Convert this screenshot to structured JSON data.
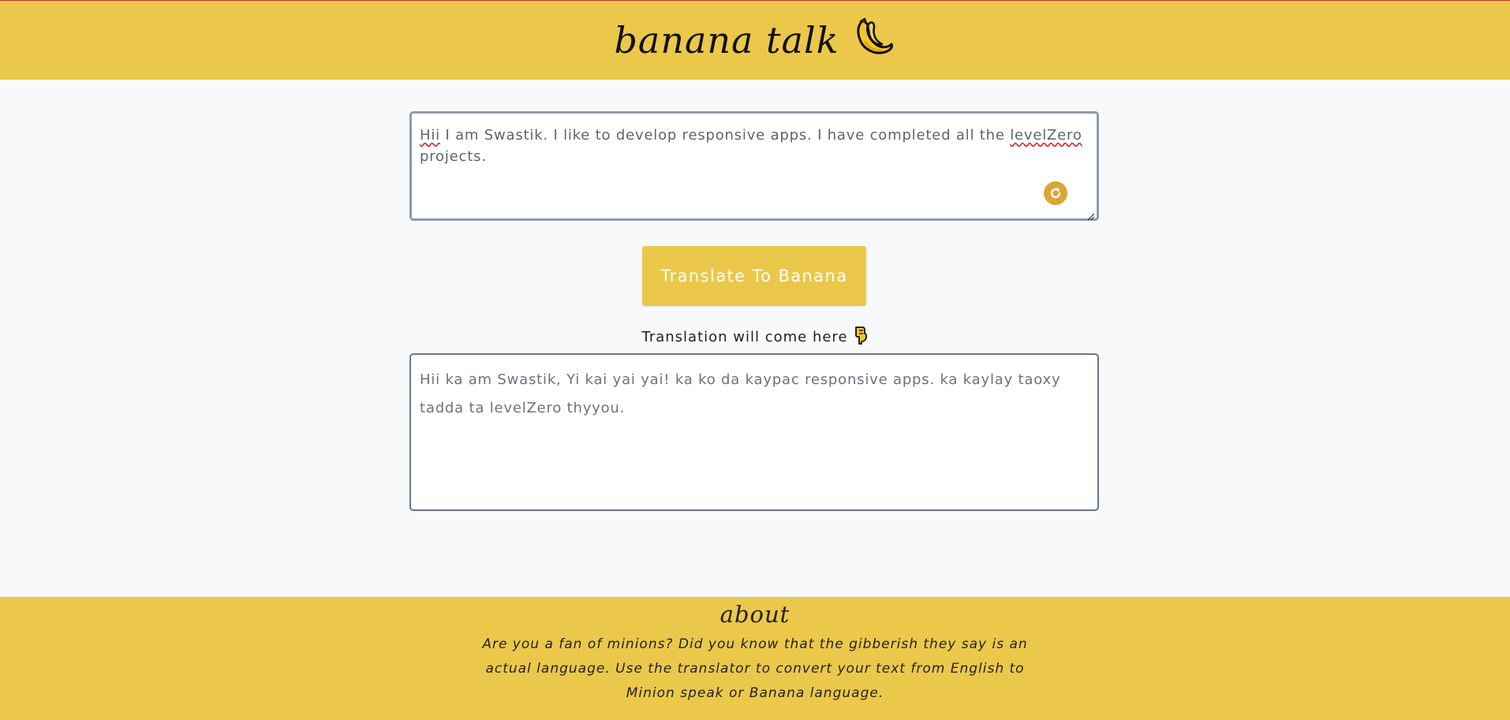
{
  "header": {
    "title": "banana talk",
    "icon": "banana-icon"
  },
  "input": {
    "word_1": "Hii",
    "text_1": " I am Swastik. I like to develop responsive apps. I have completed all the ",
    "word_2": "levelZero",
    "text_2": " projects.",
    "grammar_icon": "refresh-icon"
  },
  "translate_button": {
    "label": "Translate To Banana"
  },
  "output": {
    "label": "Translation will come here",
    "label_icon": "pointing-down-icon",
    "text": "Hii ka am Swastik, Yi kai yai yai! ka ko da kaypac responsive apps. ka kaylay taoxy tadda ta levelZero thyyou."
  },
  "footer": {
    "heading": "about",
    "text": "Are you a fan of minions? Did you know that the gibberish they say is an actual language. Use the translator to convert your text from English to Minion speak or Banana language."
  },
  "colors": {
    "brand_yellow": "#ebc84a",
    "grammar_icon": "#d8a63a",
    "background": "#f8f9fa"
  }
}
